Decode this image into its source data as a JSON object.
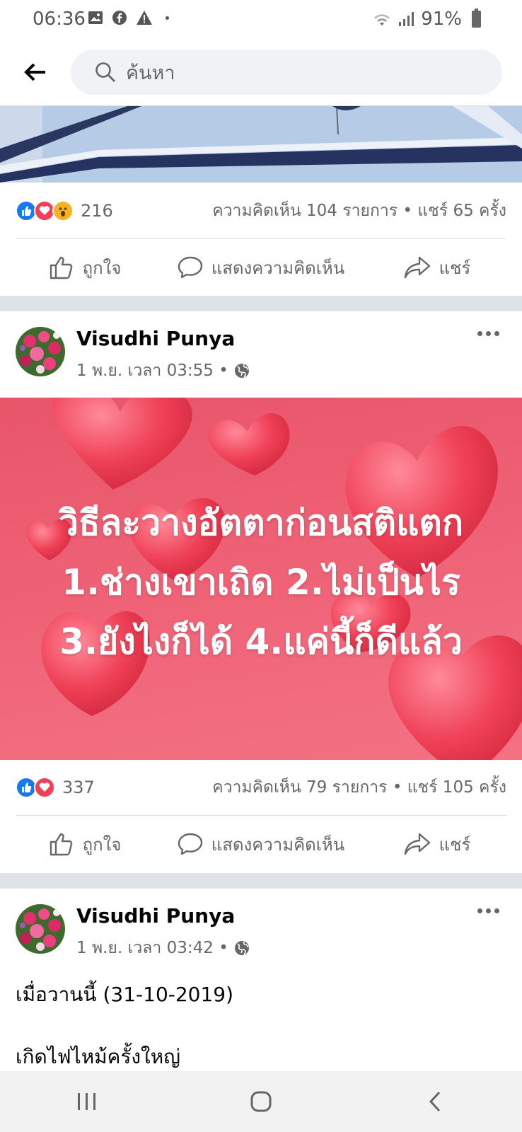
{
  "status_bar": {
    "time": "06:36",
    "battery": "91%"
  },
  "search": {
    "placeholder": "ค้นหา"
  },
  "post1": {
    "reaction_count": "216",
    "comments_shares": "ความคิดเห็น 104 รายการ • แชร์ 65 ครั้ง"
  },
  "actions": {
    "like": "ถูกใจ",
    "comment": "แสดงความคิดเห็น",
    "share": "แชร์"
  },
  "post2": {
    "author": "Visudhi Punya",
    "time": "1 พ.ย. เวลา 03:55 •",
    "image_text": [
      "วิธีละวางอัตตาก่อนสติแตก",
      "1.ช่างเขาเถิด 2.ไม่เป็นไร",
      "3.ยังไงก็ได้ 4.แค่นี้ก็ดีแล้ว"
    ],
    "reaction_count": "337",
    "comments_shares": "ความคิดเห็น 79 รายการ • แชร์ 105 ครั้ง"
  },
  "post3": {
    "author": "Visudhi Punya",
    "time": "1 พ.ย. เวลา 03:42 •",
    "text_line1": "เมื่อวานนี้ (31-10-2019)",
    "text_line2": "เกิดไฟไหม้ครั้งใหญ่"
  },
  "colors": {
    "like_blue": "#1877f2",
    "love_red": "#f33e58",
    "wow_yellow": "#f7b125",
    "secondary_text": "#65676b"
  },
  "icons": [
    "back-arrow-icon",
    "search-icon",
    "like-reaction-icon",
    "love-reaction-icon",
    "wow-reaction-icon",
    "thumbs-up-icon",
    "comment-icon",
    "share-icon",
    "globe-icon",
    "more-icon",
    "recents-icon",
    "home-icon",
    "back-nav-icon"
  ]
}
